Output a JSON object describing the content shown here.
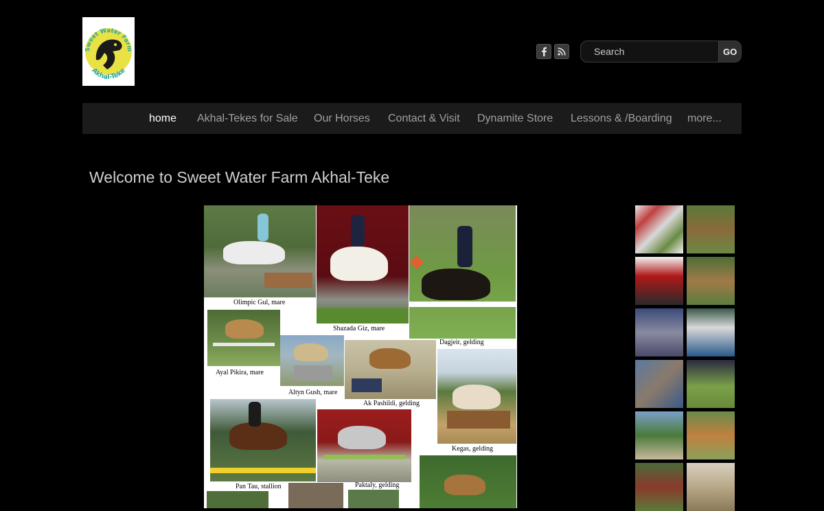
{
  "logo": {
    "text_top": "Sweet Water Farm",
    "text_bottom": "Akhal-Teke"
  },
  "social": [
    {
      "icon": "facebook-icon",
      "glyph": "f"
    },
    {
      "icon": "rss-icon",
      "glyph": "rss"
    }
  ],
  "search": {
    "placeholder": "Search",
    "button_label": "GO"
  },
  "nav": {
    "items": [
      {
        "label": "home",
        "active": true
      },
      {
        "label": "Akhal-Tekes for Sale",
        "active": false
      },
      {
        "label": "Our Horses",
        "active": false
      },
      {
        "label": "Contact & Visit",
        "active": false
      },
      {
        "label": "Dynamite Store",
        "active": false
      },
      {
        "label": "Lessons & /Boarding",
        "active": false
      },
      {
        "label": "more...",
        "active": false
      }
    ]
  },
  "main": {
    "title": "Welcome to Sweet Water Farm Akhal-Teke"
  },
  "collage": {
    "captions": [
      "Olimpic Gul, mare",
      "Shazada Giz, mare",
      "Dagjeir, gelding",
      "Ayal Pikira, mare",
      "Altyn Gush, mare",
      "Ak Pashildi, gelding",
      "Kegas, gelding",
      "Pan Tau, stallion",
      "Paktaly, gelding"
    ]
  },
  "colors": {
    "background": "#000000",
    "nav_bg": "#1b1b1b",
    "nav_text": "#a0a0a0",
    "nav_active": "#ffffff",
    "title_text": "#d0d0d0"
  }
}
